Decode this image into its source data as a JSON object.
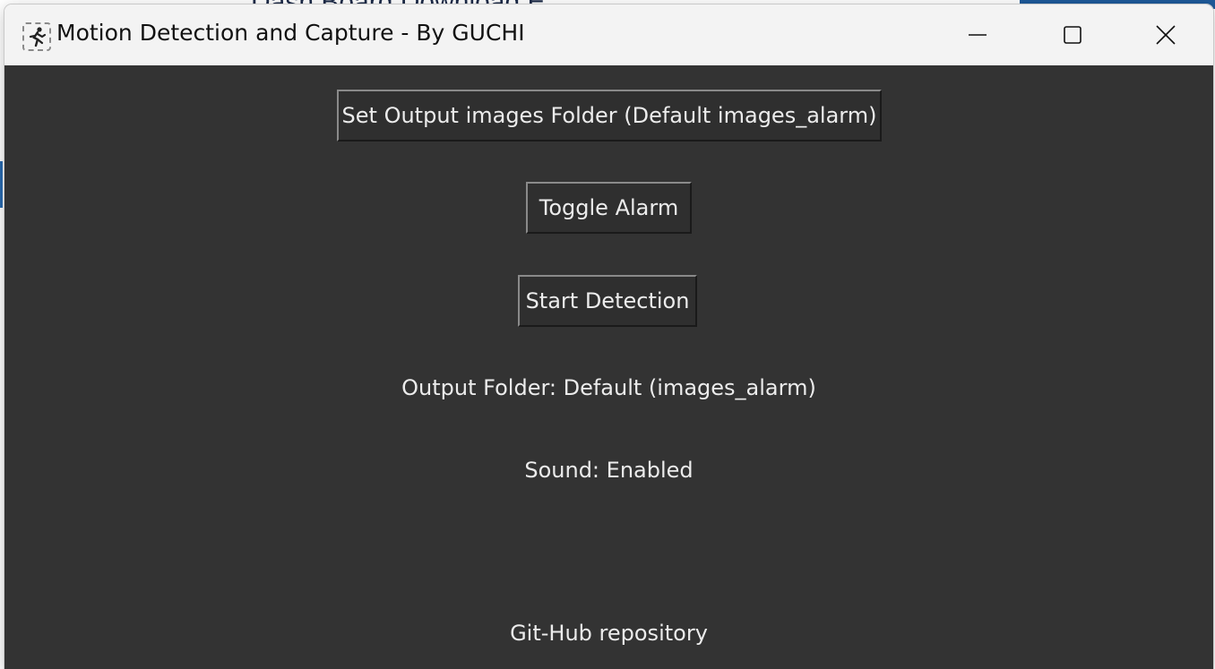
{
  "window": {
    "title": "Motion Detection and Capture - By GUCHI",
    "controls": {
      "minimize_icon": "minimize-icon",
      "maximize_icon": "maximize-icon",
      "close_icon": "close-icon"
    }
  },
  "background_app": {
    "partial_text": "Dash Board Download E"
  },
  "main": {
    "set_folder_button": "Set Output images Folder (Default images_alarm)",
    "toggle_alarm_button": "Toggle Alarm",
    "start_detection_button": "Start Detection",
    "output_folder_label": "Output Folder: Default (images_alarm)",
    "sound_label": "Sound: Enabled",
    "github_link": "Git-Hub repository"
  },
  "colors": {
    "client_bg": "#333333",
    "titlebar_bg": "#f3f3f3",
    "text": "#ececec"
  }
}
